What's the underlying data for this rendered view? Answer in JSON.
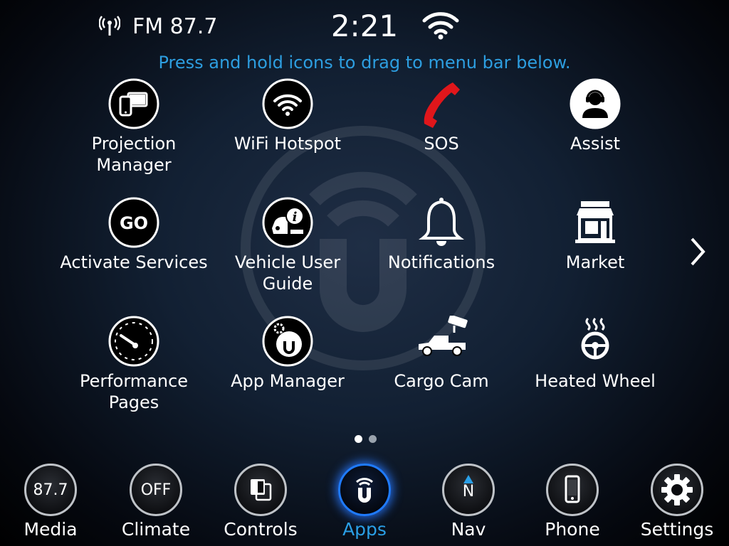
{
  "status_bar": {
    "radio_icon": "radio-antenna-icon",
    "station": "FM 87.7",
    "time": "2:21",
    "wifi_icon": "wifi-icon"
  },
  "instruction": "Press and hold icons to drag to menu bar below.",
  "apps": [
    {
      "label": "Projection\nManager",
      "icon": "projection-manager-icon"
    },
    {
      "label": "WiFi Hotspot",
      "icon": "wifi-hotspot-icon"
    },
    {
      "label": "SOS",
      "icon": "sos-phone-icon"
    },
    {
      "label": "Assist",
      "icon": "assist-headset-icon"
    },
    {
      "label": "Activate Services",
      "icon": "go-icon"
    },
    {
      "label": "Vehicle User\nGuide",
      "icon": "vehicle-info-icon"
    },
    {
      "label": "Notifications",
      "icon": "bell-icon"
    },
    {
      "label": "Market",
      "icon": "store-icon"
    },
    {
      "label": "Performance\nPages",
      "icon": "speedometer-icon"
    },
    {
      "label": "App Manager",
      "icon": "app-manager-icon"
    },
    {
      "label": "Cargo Cam",
      "icon": "truck-camera-icon"
    },
    {
      "label": "Heated Wheel",
      "icon": "heated-wheel-icon"
    }
  ],
  "pagination": {
    "pages": 2,
    "current": 1
  },
  "nav_bar": [
    {
      "label": "Media",
      "circle_text": "87.7",
      "active": false
    },
    {
      "label": "Climate",
      "circle_text": "OFF",
      "active": false
    },
    {
      "label": "Controls",
      "circle_text": "",
      "icon": "controls-icon",
      "active": false
    },
    {
      "label": "Apps",
      "circle_text": "",
      "icon": "apps-u-icon",
      "active": true
    },
    {
      "label": "Nav",
      "circle_text": "N",
      "icon": "compass-icon",
      "active": false
    },
    {
      "label": "Phone",
      "circle_text": "",
      "icon": "phone-icon",
      "active": false
    },
    {
      "label": "Settings",
      "circle_text": "",
      "icon": "gear-icon",
      "active": false
    }
  ],
  "colors": {
    "accent": "#2d9ee0",
    "active_glow": "#1f7bff",
    "sos": "#e0161b"
  }
}
